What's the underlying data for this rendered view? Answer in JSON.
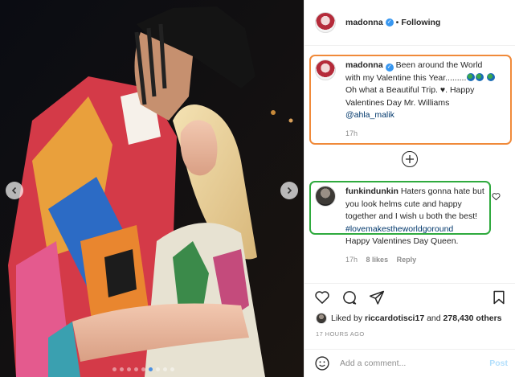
{
  "post": {
    "username": "madonna",
    "separator": "•",
    "follow_state": "Following"
  },
  "caption": {
    "username": "madonna",
    "text_1": "Been around the World with my Valentine this Year.........",
    "text_2": "Oh what a Beautiful Trip. ♥. Happy Valentines Day Mr. Williams",
    "mention": "@ahla_malik",
    "time": "17h"
  },
  "comment": {
    "username": "funkindunkin",
    "text": "Haters gonna hate but you look helms cute and happy together and I wish u both the best!",
    "hashtag": "#lovemakestheworldgoround",
    "text_after": "Happy Valentines Day Queen.",
    "time": "17h",
    "likes": "8 likes",
    "reply": "Reply"
  },
  "likes": {
    "prefix": "Liked by",
    "user": "riccardotisci17",
    "conjunction": "and",
    "others": "278,430 others"
  },
  "timestamp": "17 HOURS AGO",
  "add_comment": {
    "placeholder": "Add a comment...",
    "post_label": "Post"
  },
  "carousel": {
    "slide_count": 9,
    "active_index": 5
  },
  "colors": {
    "caption_highlight": "#f08a3a",
    "comment_highlight": "#2faa3e",
    "verified": "#3897f0",
    "link": "#00376b",
    "post_button_disabled": "#b2dffc"
  }
}
